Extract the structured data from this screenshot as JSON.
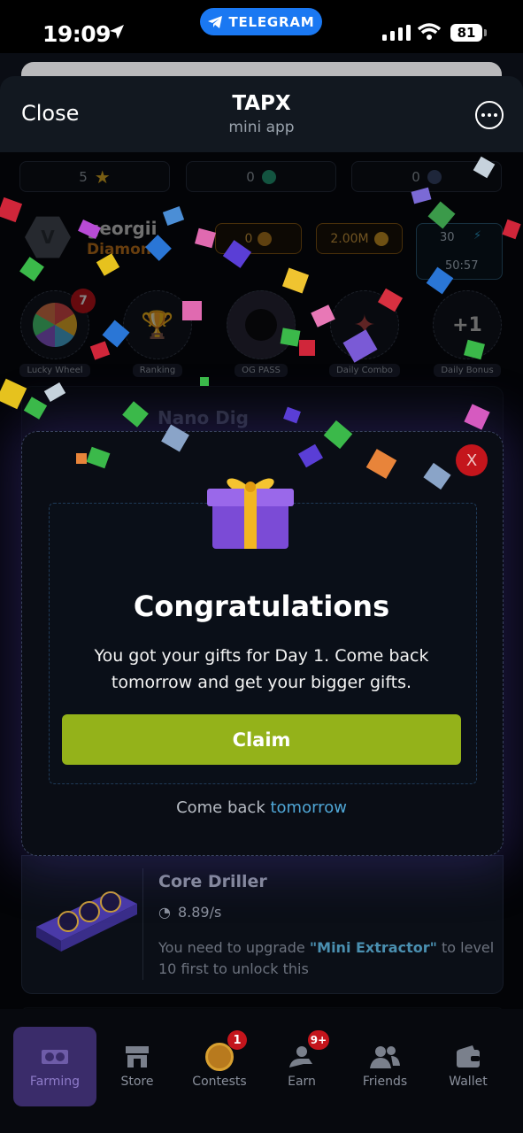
{
  "status_bar": {
    "time": "19:09",
    "pill": "TELEGRAM",
    "battery": "81"
  },
  "header": {
    "close": "Close",
    "title": "TAPX",
    "subtitle": "mini app"
  },
  "stats": {
    "stars": "5",
    "usdt": "0",
    "ton": "0"
  },
  "user": {
    "name": "georgii",
    "rank": "Diamond",
    "coins_a": "0",
    "coins_b": "2.00M",
    "energy_top": "30",
    "energy_time": "50:57"
  },
  "features": [
    {
      "label": "Lucky Wheel",
      "badge": "7"
    },
    {
      "label": "Ranking"
    },
    {
      "label": "OG PASS"
    },
    {
      "label": "Daily Combo"
    },
    {
      "label": "Daily Bonus"
    }
  ],
  "background_card": {
    "title": "Nano Dig"
  },
  "modal": {
    "close": "X",
    "title": "Congratulations",
    "message": "You got your gifts for Day 1. Come back tomorrow and get your bigger gifts.",
    "claim": "Claim",
    "comeback_prefix": "Come back",
    "comeback_link": "tomorrow"
  },
  "driller": {
    "title": "Core Driller",
    "rate": "8.89/s",
    "note_prefix": "You need to upgrade ",
    "note_highlight": "\"Mini Extractor\"",
    "note_suffix": " to level 10 first to unlock this"
  },
  "nav": [
    {
      "label": "Farming",
      "active": true
    },
    {
      "label": "Store"
    },
    {
      "label": "Contests",
      "badge": "1"
    },
    {
      "label": "Earn",
      "badge": "9+"
    },
    {
      "label": "Friends"
    },
    {
      "label": "Wallet"
    }
  ],
  "colors": {
    "accent": "#94b21a",
    "danger": "#c4151c",
    "link": "#4fa6d6",
    "telegram": "#1a78f2",
    "nav_active": "#3a2c6a"
  }
}
